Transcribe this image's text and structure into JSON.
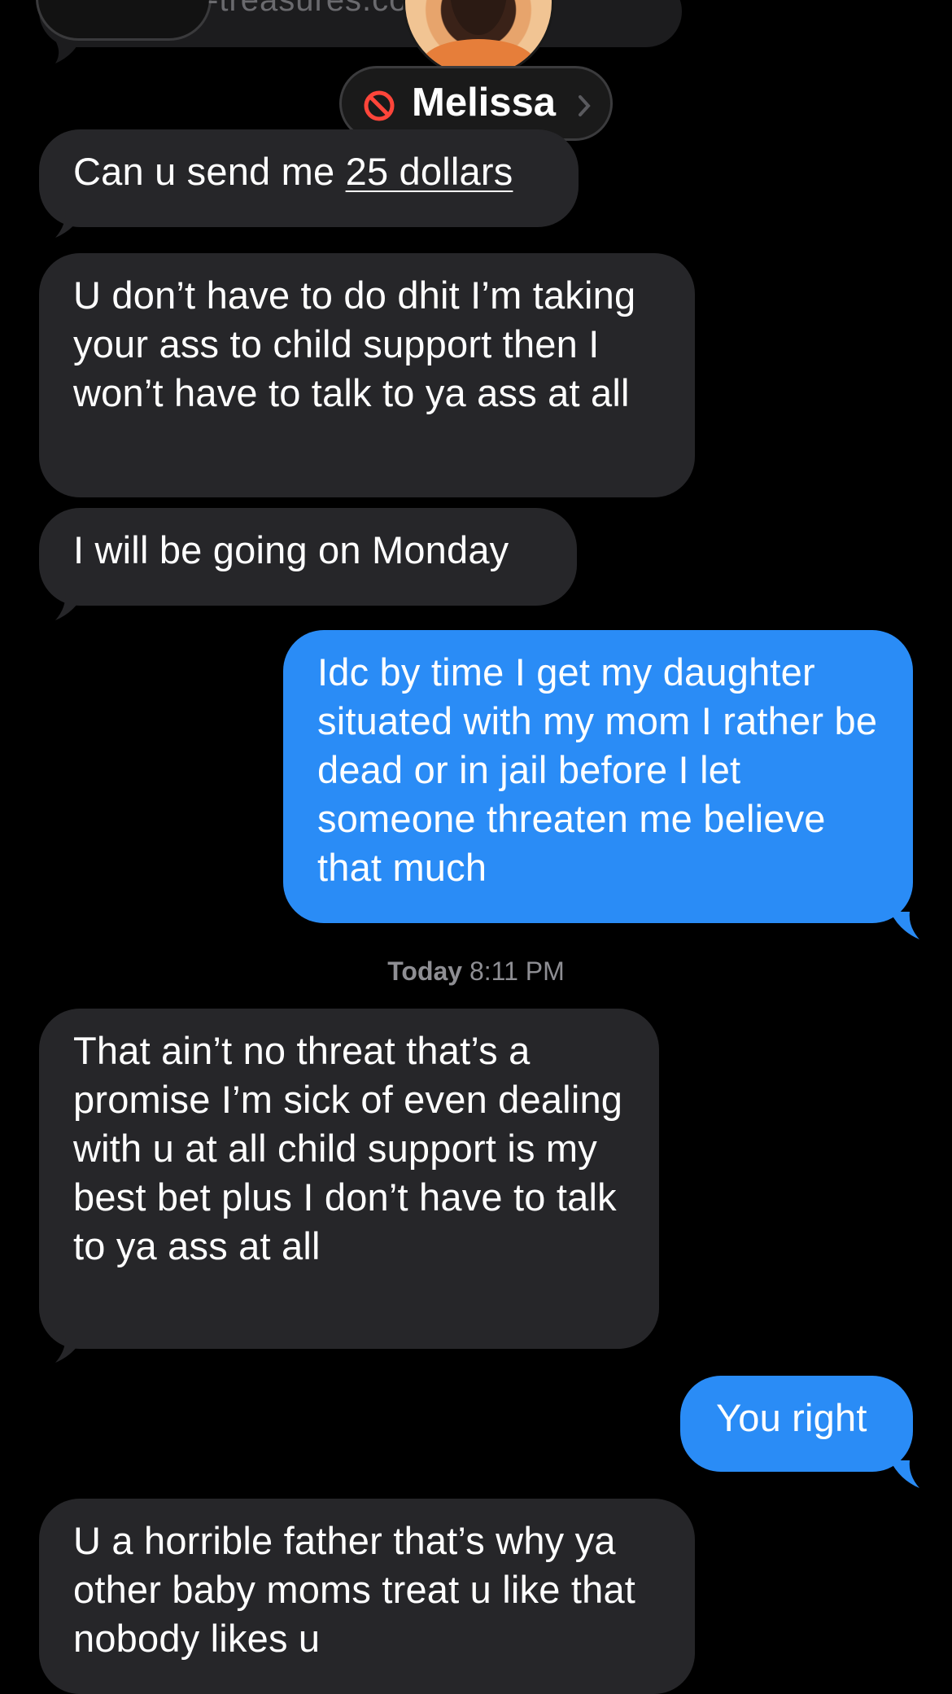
{
  "header": {
    "partial_link_text": "-treasures.co",
    "contact_name": "Melissa",
    "contact_status_icon": "blocked-icon"
  },
  "messages": [
    {
      "side": "incoming",
      "text_before": "Can u send me ",
      "link_text": "25 dollars"
    },
    {
      "side": "incoming",
      "text": "U don’t have to do dhit I’m taking your ass to child support then I won’t have to talk to ya ass at all"
    },
    {
      "side": "incoming",
      "text": "I will be going on Monday"
    },
    {
      "side": "outgoing",
      "text": "Idc by time I get my daughter situated with my mom I rather be dead or in jail before I let someone threaten me believe that much"
    },
    {
      "side": "incoming",
      "text": "That ain’t no threat that’s a promise I’m sick of even dealing with u at all child support is my best bet plus I don’t have to talk to ya ass at all"
    },
    {
      "side": "outgoing",
      "text": "You right"
    },
    {
      "side": "incoming",
      "text": "U a horrible father that’s why ya other baby moms treat u like that nobody likes u"
    }
  ],
  "timestamp": {
    "day": "Today",
    "time": "8:11 PM"
  },
  "colors": {
    "background": "#000000",
    "incoming_bubble": "#262629",
    "outgoing_bubble": "#2a8cf6",
    "blocked_icon": "#ff453a",
    "timestamp_text": "#8e8e93"
  }
}
